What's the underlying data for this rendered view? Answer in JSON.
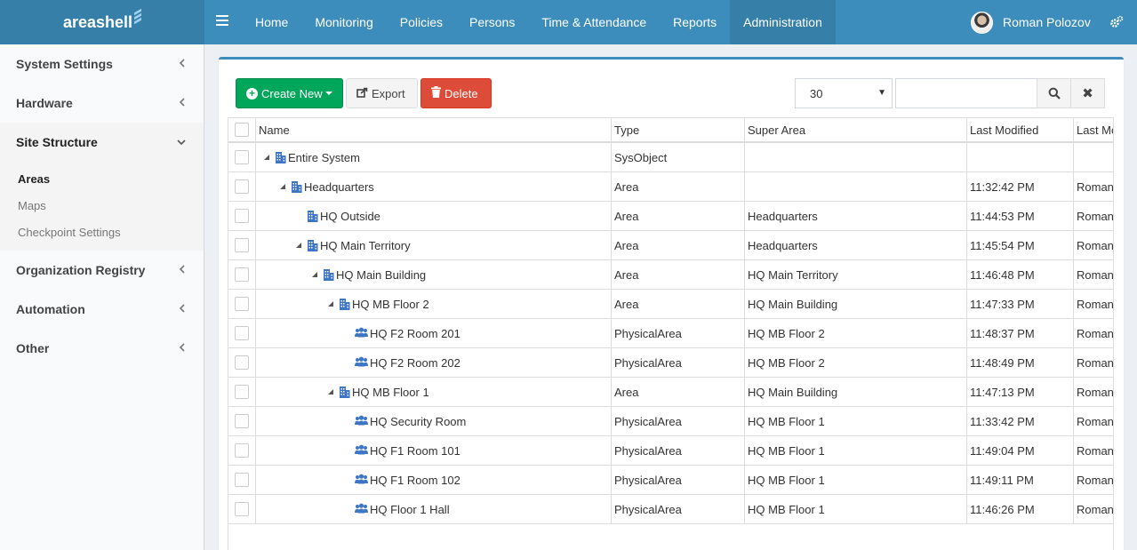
{
  "header": {
    "brand": "areashell",
    "nav": [
      "Home",
      "Monitoring",
      "Policies",
      "Persons",
      "Time & Attendance",
      "Reports",
      "Administration"
    ],
    "active_nav": "Administration",
    "user_name": "Roman Polozov"
  },
  "sidebar": {
    "items": [
      {
        "label": "System Settings",
        "open": false
      },
      {
        "label": "Hardware",
        "open": false
      },
      {
        "label": "Site Structure",
        "open": true
      },
      {
        "label": "Organization Registry",
        "open": false
      },
      {
        "label": "Automation",
        "open": false
      },
      {
        "label": "Other",
        "open": false
      }
    ],
    "subitems": [
      "Areas",
      "Maps",
      "Checkpoint Settings"
    ],
    "active_subitem": "Areas"
  },
  "toolbar": {
    "create_label": "Create New",
    "export_label": "Export",
    "delete_label": "Delete",
    "page_size": "30",
    "search_value": ""
  },
  "table": {
    "columns": [
      "Name",
      "Type",
      "Super Area",
      "Last Modified",
      "Last Mo"
    ],
    "rows": [
      {
        "name": "Entire System",
        "depth": 0,
        "expand": true,
        "icon": "building-icon",
        "type": "SysObject",
        "super": "",
        "modified": "",
        "modby": ""
      },
      {
        "name": "Headquarters",
        "depth": 1,
        "expand": true,
        "icon": "building-icon",
        "type": "Area",
        "super": "",
        "modified": "11:32:42 PM",
        "modby": "Roman"
      },
      {
        "name": "HQ Outside",
        "depth": 2,
        "expand": false,
        "icon": "building-icon",
        "type": "Area",
        "super": "Headquarters",
        "modified": "11:44:53 PM",
        "modby": "Roman"
      },
      {
        "name": "HQ Main Territory",
        "depth": 2,
        "expand": true,
        "icon": "building-icon",
        "type": "Area",
        "super": "Headquarters",
        "modified": "11:45:54 PM",
        "modby": "Roman"
      },
      {
        "name": "HQ Main Building",
        "depth": 3,
        "expand": true,
        "icon": "building-icon",
        "type": "Area",
        "super": "HQ Main Territory",
        "modified": "11:46:48 PM",
        "modby": "Roman"
      },
      {
        "name": "HQ MB Floor 2",
        "depth": 4,
        "expand": true,
        "icon": "building-icon",
        "type": "Area",
        "super": "HQ Main Building",
        "modified": "11:47:33 PM",
        "modby": "Roman"
      },
      {
        "name": "HQ F2 Room 201",
        "depth": 5,
        "expand": false,
        "icon": "people-icon",
        "type": "PhysicalArea",
        "super": "HQ MB Floor 2",
        "modified": "11:48:37 PM",
        "modby": "Roman"
      },
      {
        "name": "HQ F2 Room 202",
        "depth": 5,
        "expand": false,
        "icon": "people-icon",
        "type": "PhysicalArea",
        "super": "HQ MB Floor 2",
        "modified": "11:48:49 PM",
        "modby": "Roman"
      },
      {
        "name": "HQ MB Floor 1",
        "depth": 4,
        "expand": true,
        "icon": "building-icon",
        "type": "Area",
        "super": "HQ Main Building",
        "modified": "11:47:13 PM",
        "modby": "Roman"
      },
      {
        "name": "HQ Security Room",
        "depth": 5,
        "expand": false,
        "icon": "people-icon",
        "type": "PhysicalArea",
        "super": "HQ MB Floor 1",
        "modified": "11:33:42 PM",
        "modby": "Roman"
      },
      {
        "name": "HQ F1 Room 101",
        "depth": 5,
        "expand": false,
        "icon": "people-icon",
        "type": "PhysicalArea",
        "super": "HQ MB Floor 1",
        "modified": "11:49:04 PM",
        "modby": "Roman"
      },
      {
        "name": "HQ F1 Room 102",
        "depth": 5,
        "expand": false,
        "icon": "people-icon",
        "type": "PhysicalArea",
        "super": "HQ MB Floor 1",
        "modified": "11:49:11 PM",
        "modby": "Roman"
      },
      {
        "name": "HQ Floor 1 Hall",
        "depth": 5,
        "expand": false,
        "icon": "people-icon",
        "type": "PhysicalArea",
        "super": "HQ MB Floor 1",
        "modified": "11:46:26 PM",
        "modby": "Roman"
      }
    ]
  },
  "colors": {
    "header": "#3c8dbc",
    "header_dark": "#367fa9",
    "create": "#00a65a",
    "delete": "#dd4b39",
    "tree_icon": "#3c76c4"
  }
}
